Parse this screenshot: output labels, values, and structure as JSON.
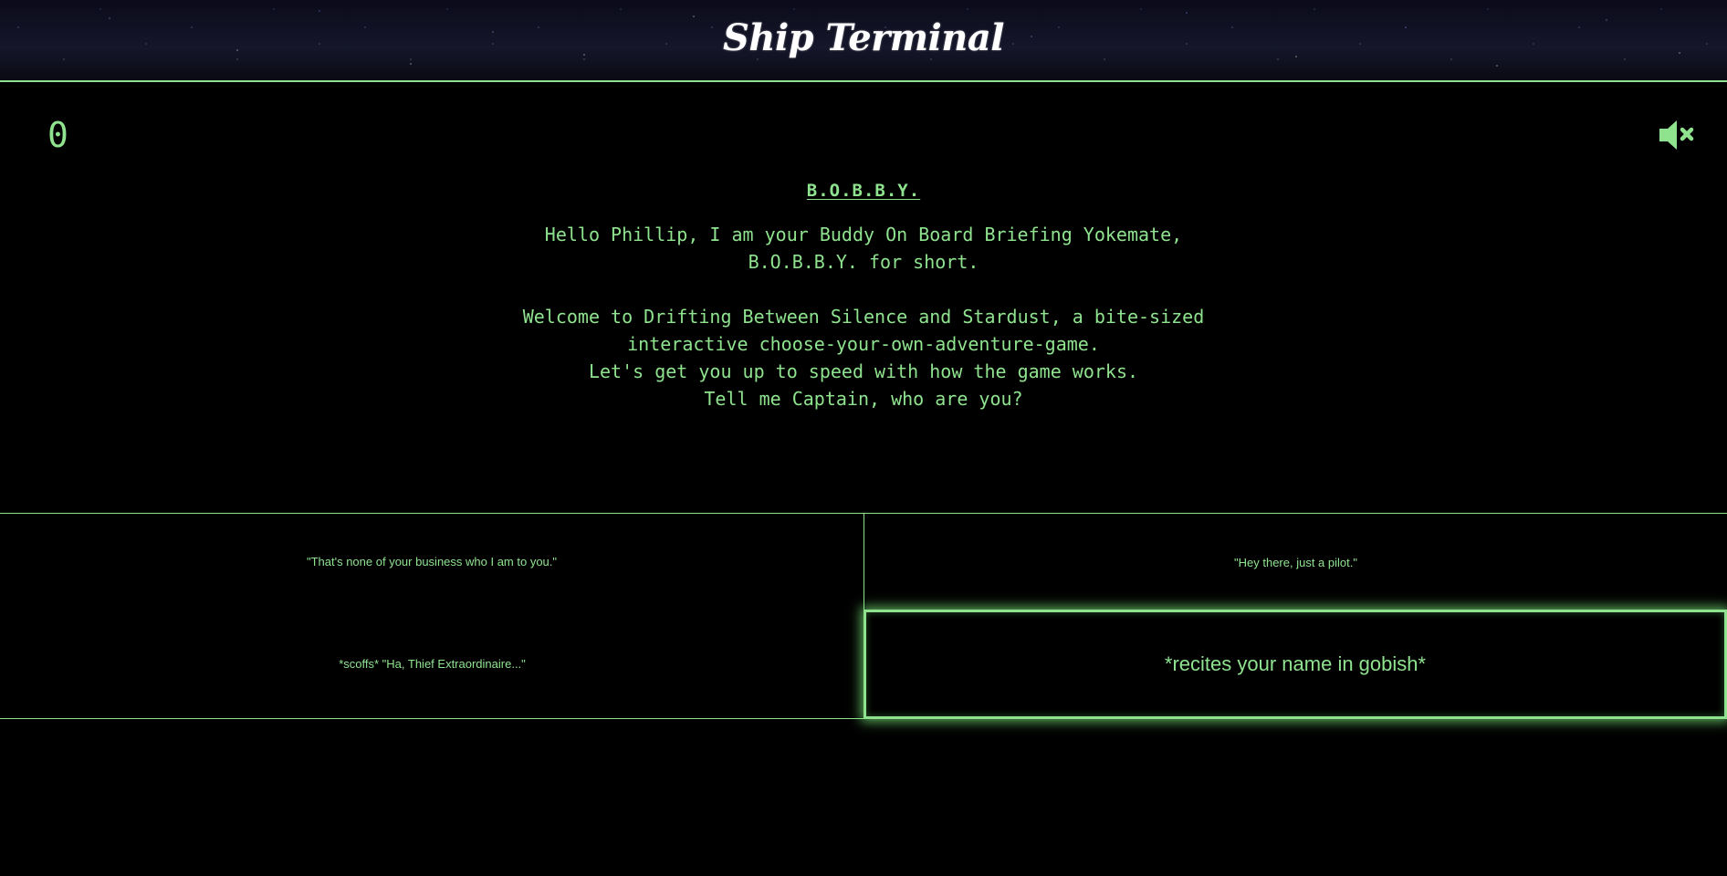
{
  "app": {
    "title": "Ship Terminal"
  },
  "hud": {
    "score": "0",
    "mute_icon": "speaker-muted-icon"
  },
  "dialogue": {
    "speaker": "B.O.B.B.Y.",
    "lines": [
      "Hello Phillip, I am your Buddy On Board Briefing Yokemate,",
      "B.O.B.B.Y. for short.",
      "",
      "Welcome to Drifting Between Silence and Stardust, a bite-sized",
      "interactive choose-your-own-adventure-game.",
      "Let's get you up to speed with how the game works.",
      "Tell me Captain, who are you?"
    ]
  },
  "choices": [
    {
      "label": "\"That's none of your business who I am to you.\""
    },
    {
      "label": "\"Hey there, just a pilot.\""
    },
    {
      "label": "*scoffs* \"Ha, Thief Extraordinaire...\""
    },
    {
      "label": "*recites your name in gobish*",
      "state": "hovered"
    }
  ],
  "colors": {
    "terminal_green": "#8fe38f",
    "background": "#000000",
    "title": "#ffffff"
  }
}
